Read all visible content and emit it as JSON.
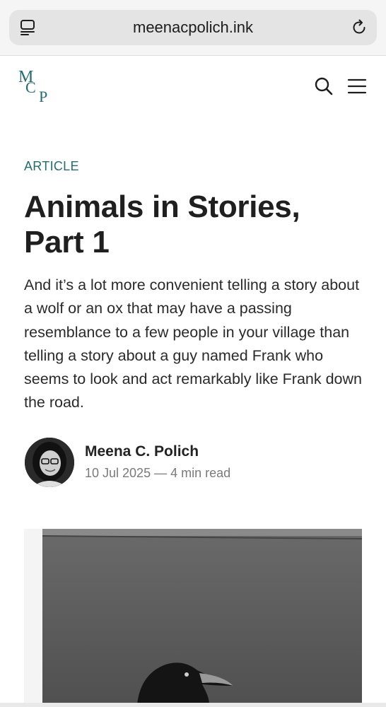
{
  "browser": {
    "url": "meenacpolich.ink",
    "tabs_icon": "tabs-icon",
    "reload_icon": "reload-icon"
  },
  "header": {
    "logo_icon": "mcp-monogram-logo",
    "logo_letters": "MCP",
    "brand_color": "#236d72",
    "search_icon": "search-icon",
    "menu_icon": "hamburger-menu-icon"
  },
  "article": {
    "kicker": "ARTICLE",
    "title": "Animals in Stories, Part 1",
    "excerpt": "And it’s a lot more convenient telling a story about a wolf or an ox that may have a passing resemblance to a few people in your village than telling a story about a guy named Frank who seems to look and act remarkably like Frank down the road.",
    "author": {
      "name": "Meena C. Polich",
      "date": "10 Jul 2025",
      "separator": "—",
      "read_time": "4 min read"
    },
    "feature_image": "black-and-white-crow-photo"
  }
}
